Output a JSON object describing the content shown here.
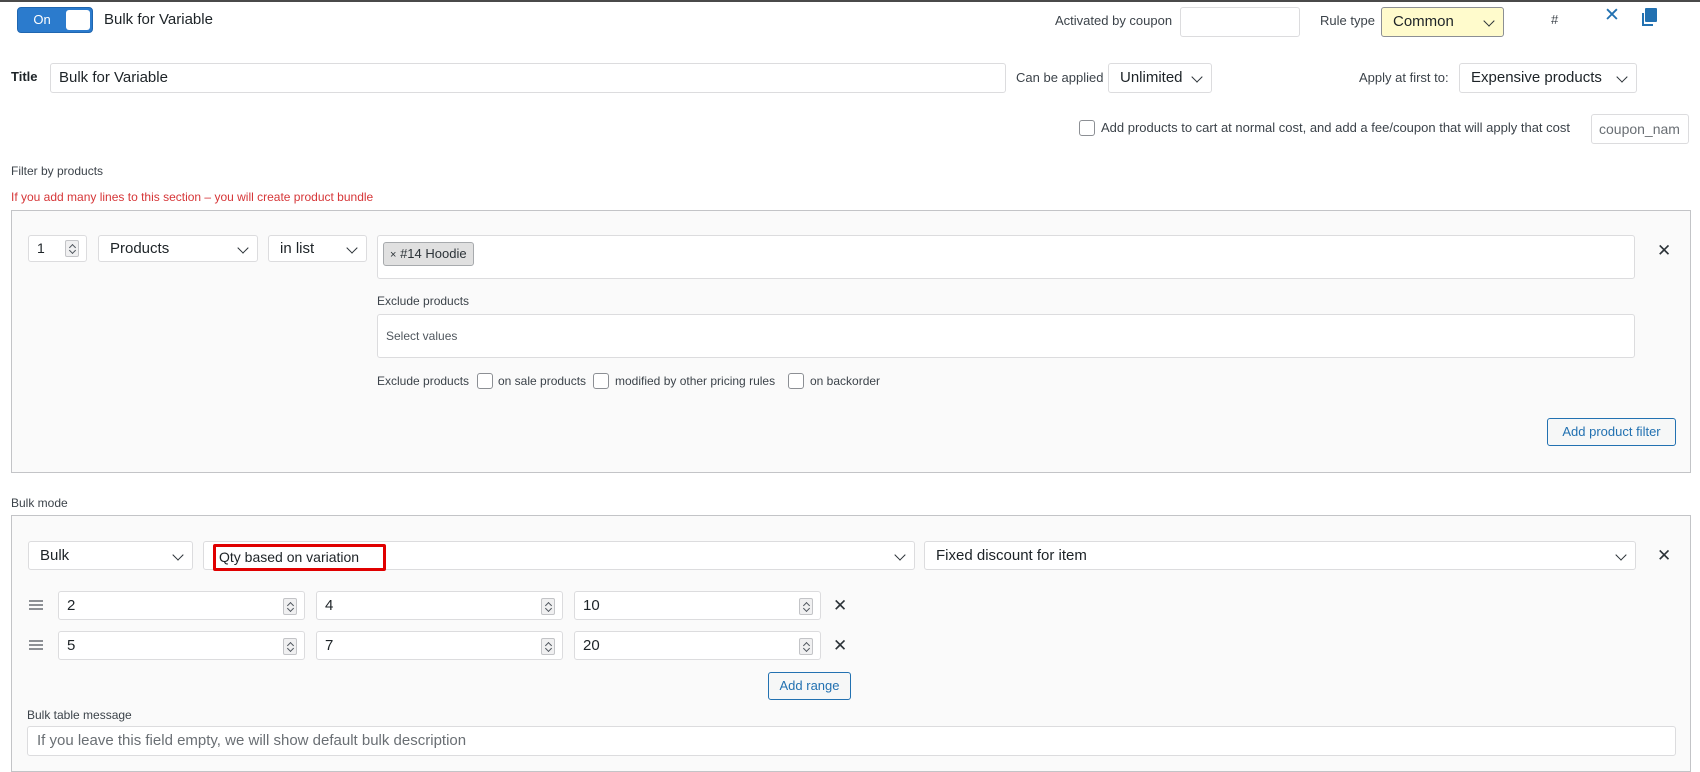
{
  "rule": {
    "toggle_label": "On",
    "name": "Bulk for Variable",
    "activated_by_coupon_label": "Activated by coupon",
    "activated_by_coupon_value": "",
    "rule_type_label": "Rule type",
    "rule_type_value": "Common",
    "hash_label": "#"
  },
  "title_row": {
    "title_label": "Title",
    "title_value": "Bulk for Variable",
    "can_be_applied_label": "Can be applied",
    "can_be_applied_value": "Unlimited",
    "apply_first_label": "Apply at first to:",
    "apply_first_value": "Expensive products"
  },
  "fee_row": {
    "checkbox_label": "Add products to cart at normal cost, and add a fee/coupon that will apply that cost",
    "coupon_placeholder": "coupon_nam"
  },
  "filter": {
    "section_title": "Filter by products",
    "warning": "If you add many lines to this section – you will create product bundle",
    "qty_value": "1",
    "type_value": "Products",
    "condition_value": "in list",
    "tag_remove": "×",
    "tag_label": "#14 Hoodie",
    "exclude_label": "Exclude products",
    "exclude_placeholder": "Select values",
    "exclude_products_label": "Exclude products",
    "on_sale_label": "on sale products",
    "modified_label": "modified by other pricing rules",
    "backorder_label": "on backorder",
    "add_filter_button": "Add product filter"
  },
  "bulk": {
    "section_title": "Bulk mode",
    "mode_value": "Bulk",
    "qty_based_value": "Qty based on variation",
    "discount_type_value": "Fixed discount for item",
    "ranges": [
      {
        "from": "2",
        "to": "4",
        "value": "10"
      },
      {
        "from": "5",
        "to": "7",
        "value": "20"
      }
    ],
    "add_range_button": "Add range",
    "table_message_label": "Bulk table message",
    "table_message_placeholder": "If you leave this field empty, we will show default bulk description"
  },
  "colors": {
    "accent": "#2271b1",
    "toggle_on": "#2b7bcd",
    "rule_type_bg": "#fffbcc",
    "warning_red": "#d63638",
    "highlight_box": "#e00000"
  }
}
